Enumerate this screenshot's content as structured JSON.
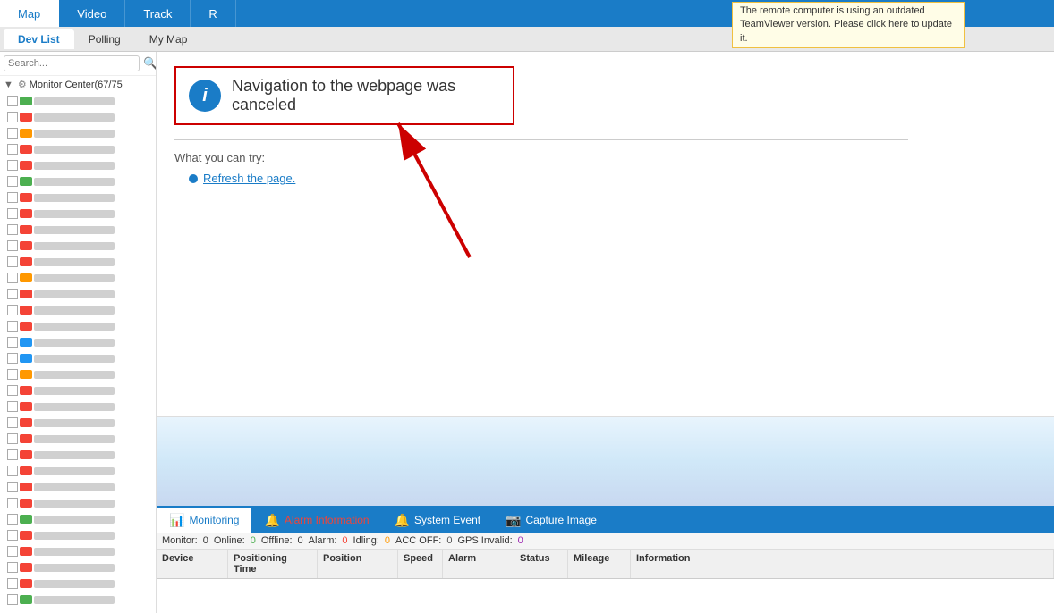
{
  "topnav": {
    "tabs": [
      {
        "label": "Map",
        "active": true
      },
      {
        "label": "Video",
        "active": false
      },
      {
        "label": "Track",
        "active": false
      },
      {
        "label": "R",
        "active": false
      }
    ],
    "teamviewer_notice": "The remote computer is using an outdated TeamViewer version. Please click here to update it."
  },
  "subtabs": {
    "tabs": [
      {
        "label": "Dev List",
        "active": true
      },
      {
        "label": "Polling",
        "active": false
      },
      {
        "label": "My Map",
        "active": false
      }
    ]
  },
  "sidebar": {
    "search_placeholder": "Search...",
    "tree_root_label": "Monitor Center(67/75",
    "search_icon": "🔍"
  },
  "browser_error": {
    "title": "Navigation to the webpage was canceled",
    "what_try": "What you can try:",
    "refresh_link": "Refresh the page."
  },
  "bottom_tabs": {
    "tabs": [
      {
        "label": "Monitoring",
        "active": true,
        "icon": "📊"
      },
      {
        "label": "Alarm Information",
        "active": false,
        "icon": "🔔"
      },
      {
        "label": "System Event",
        "active": false,
        "icon": "🔔"
      },
      {
        "label": "Capture Image",
        "active": false,
        "icon": "📷"
      }
    ]
  },
  "status_bar": {
    "monitor_label": "Monitor:",
    "monitor_val": "0",
    "online_label": "Online:",
    "online_val": "0",
    "offline_label": "Offline:",
    "offline_val": "0",
    "alarm_label": "Alarm:",
    "alarm_val": "0",
    "idling_label": "Idling:",
    "idling_val": "0",
    "accoff_label": "ACC OFF:",
    "accoff_val": "0",
    "gpsinvalid_label": "GPS Invalid:",
    "gpsinvalid_val": "0"
  },
  "table_headers": {
    "device": "Device",
    "positioning_time": "Positioning Time",
    "position": "Position",
    "speed": "Speed",
    "alarm": "Alarm",
    "status": "Status",
    "mileage": "Mileage",
    "information": "Information"
  },
  "device_indicators": [
    "green",
    "red",
    "orange",
    "red",
    "red",
    "green",
    "red",
    "red",
    "red",
    "red",
    "red",
    "orange",
    "red",
    "red",
    "red",
    "blue",
    "blue",
    "orange",
    "red",
    "red",
    "red",
    "red",
    "red",
    "red",
    "red",
    "red",
    "green",
    "red",
    "red",
    "red",
    "red",
    "green"
  ]
}
